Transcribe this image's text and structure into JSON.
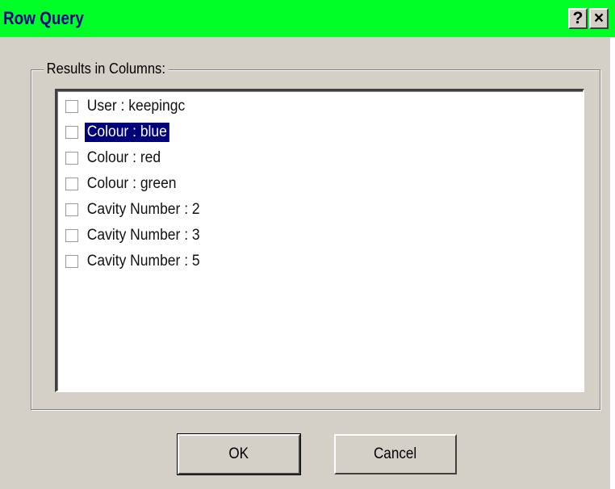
{
  "window": {
    "title": "Row Query",
    "help_label": "?",
    "close_label": "×"
  },
  "group": {
    "label": "Results in Columns:"
  },
  "list": {
    "items": [
      {
        "label": "User : keepingc",
        "checked": false,
        "selected": false
      },
      {
        "label": "Colour : blue",
        "checked": false,
        "selected": true
      },
      {
        "label": "Colour : red",
        "checked": false,
        "selected": false
      },
      {
        "label": "Colour : green",
        "checked": false,
        "selected": false
      },
      {
        "label": "Cavity Number : 2",
        "checked": false,
        "selected": false
      },
      {
        "label": "Cavity Number : 3",
        "checked": false,
        "selected": false
      },
      {
        "label": "Cavity Number : 5",
        "checked": false,
        "selected": false
      }
    ]
  },
  "buttons": {
    "ok_label": "OK",
    "cancel_label": "Cancel"
  },
  "colors": {
    "titlebar": "#00ff26",
    "title_text": "#00008a",
    "selection": "#00007b",
    "dialog_bg": "#d4d0c8"
  }
}
